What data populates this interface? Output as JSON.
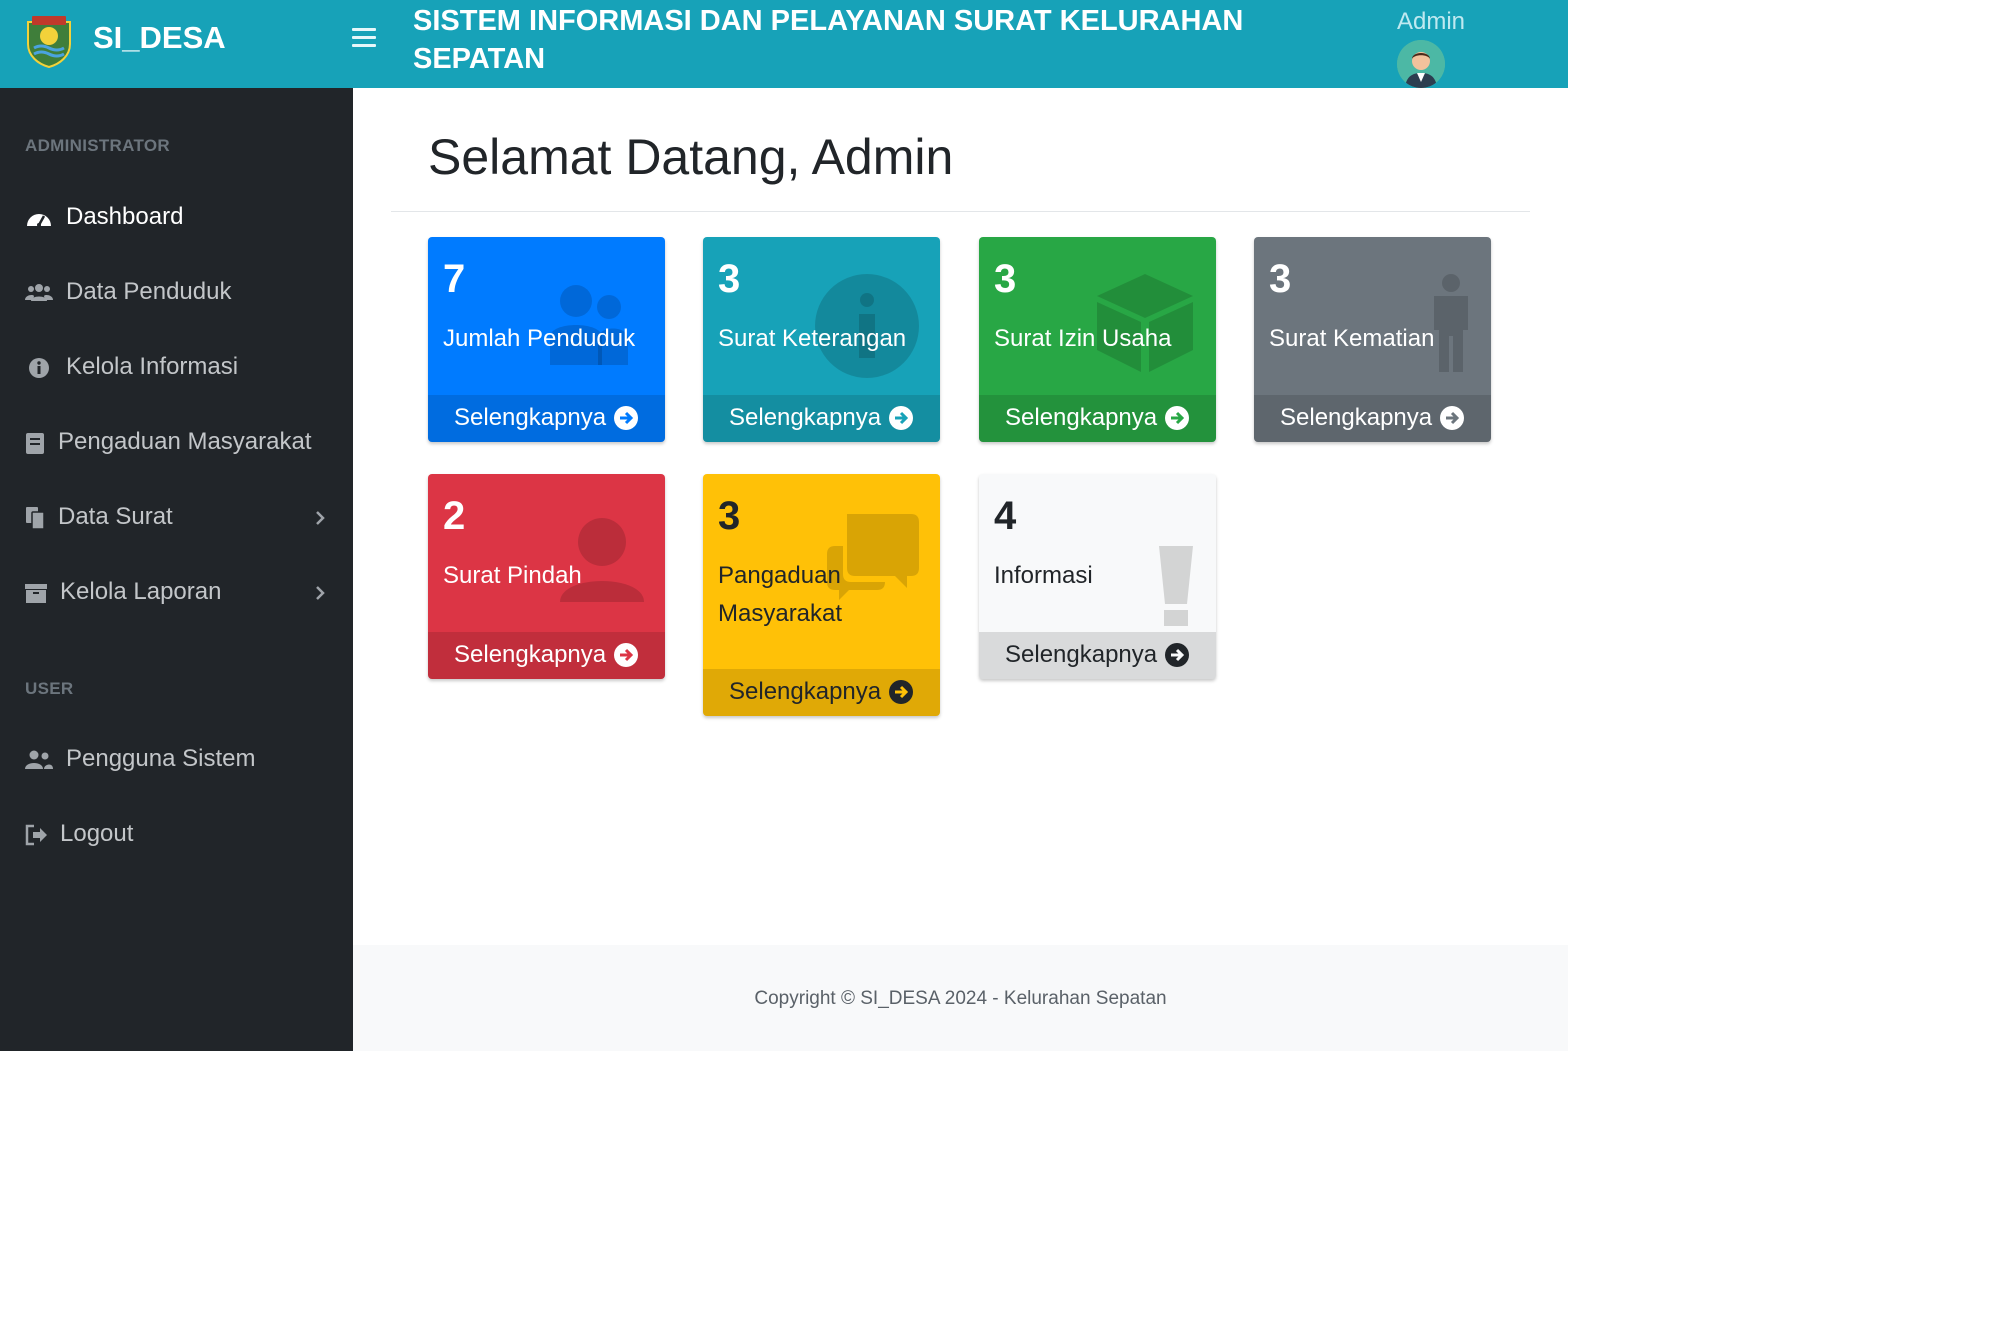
{
  "header": {
    "brand": "SI_DESA",
    "title": "SISTEM INFORMASI DAN PELAYANAN SURAT KELURAHAN SEPATAN",
    "user_name": "Admin"
  },
  "sidebar": {
    "section_admin": "ADMINISTRATOR",
    "section_user": "USER",
    "items": [
      {
        "label": "Dashboard",
        "icon": "speedometer-icon"
      },
      {
        "label": "Data Penduduk",
        "icon": "users-icon"
      },
      {
        "label": "Kelola Informasi",
        "icon": "info-circle-icon"
      },
      {
        "label": "Pengaduan Masyarakat",
        "icon": "book-icon"
      },
      {
        "label": "Data Surat",
        "icon": "copy-files-icon"
      },
      {
        "label": "Kelola Laporan",
        "icon": "archive-icon"
      },
      {
        "label": "Pengguna Sistem",
        "icon": "user-group-icon"
      },
      {
        "label": "Logout",
        "icon": "sign-out-icon"
      }
    ]
  },
  "main": {
    "title": "Selamat Datang, Admin",
    "more_label": "Selengkapnya",
    "cards": [
      {
        "count": "7",
        "title": "Jumlah Penduduk",
        "color": "#007bff"
      },
      {
        "count": "3",
        "title": "Surat Keterangan",
        "color": "#17a2b8"
      },
      {
        "count": "3",
        "title": "Surat Izin Usaha",
        "color": "#28a745"
      },
      {
        "count": "3",
        "title": "Surat Kematian",
        "color": "#6c757d"
      },
      {
        "count": "2",
        "title": "Surat Pindah",
        "color": "#dc3545"
      },
      {
        "count": "3",
        "title": "Pangaduan Masyarakat",
        "color": "#ffc107"
      },
      {
        "count": "4",
        "title": "Informasi",
        "color": "#f8f9fa"
      }
    ]
  },
  "footer": {
    "copyright": "Copyright © SI_DESA 2024 - Kelurahan Sepatan"
  },
  "colors": {
    "topbar": "#17a2b8",
    "sidebar": "#212529"
  }
}
